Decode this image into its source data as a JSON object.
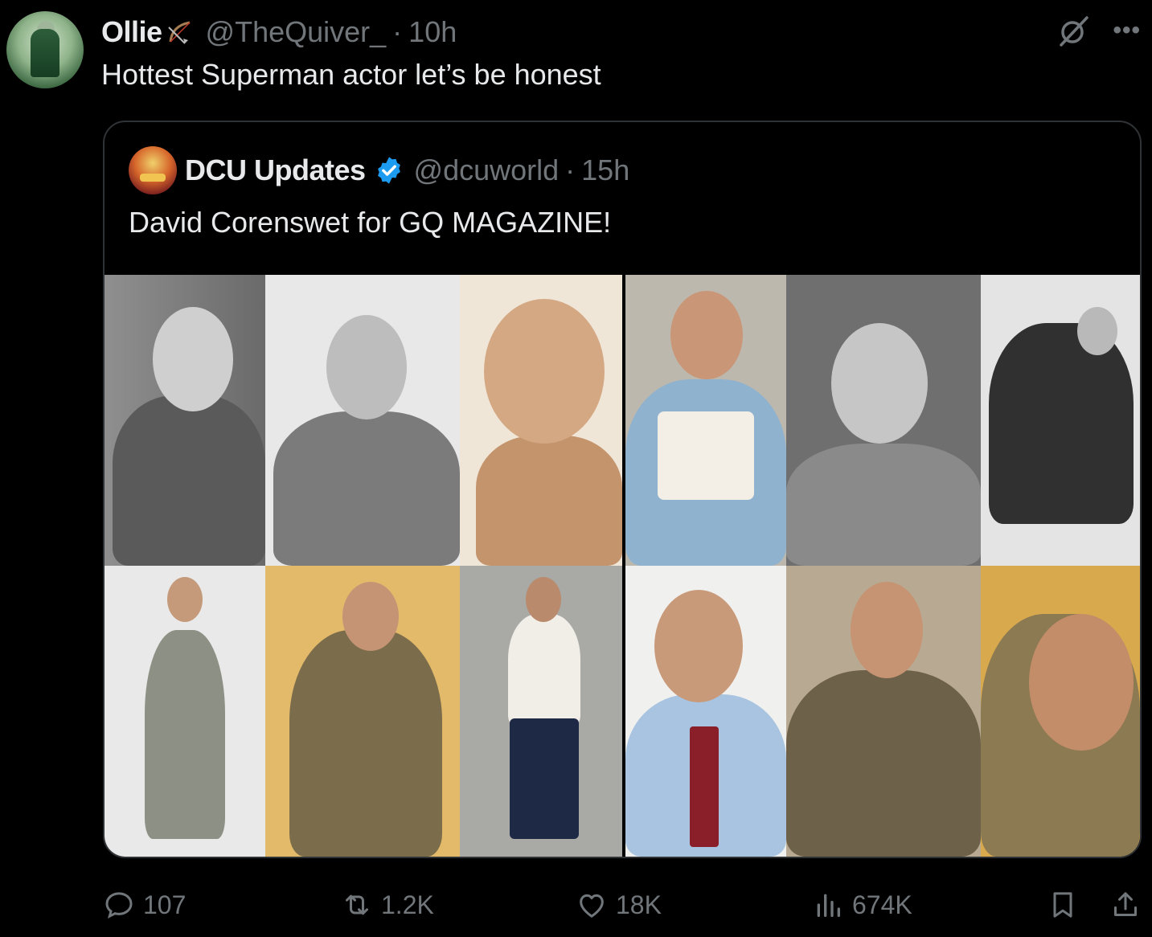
{
  "tweet": {
    "author_name": "Ollie",
    "author_handle": "@TheQuiver_",
    "separator": "·",
    "time": "10h",
    "text": "Hottest Superman actor let’s be honest"
  },
  "quote": {
    "author_name": "DCU Updates",
    "author_handle": "@dcuworld",
    "separator": "·",
    "time": "15h",
    "text": "David Corenswet for GQ MAGAZINE!"
  },
  "actions": {
    "replies": "107",
    "reposts": "1.2K",
    "likes": "18K",
    "views": "674K"
  },
  "icons": [
    "bow-arrow-icon",
    "grok-icon",
    "more-icon",
    "verified-icon",
    "reply-icon",
    "repost-icon",
    "like-icon",
    "views-icon",
    "bookmark-icon",
    "share-icon"
  ],
  "colors": {
    "background": "#000000",
    "text": "#e7e9ea",
    "muted": "#71767b",
    "border": "#2f3336",
    "verified": "#1d9bf0"
  }
}
